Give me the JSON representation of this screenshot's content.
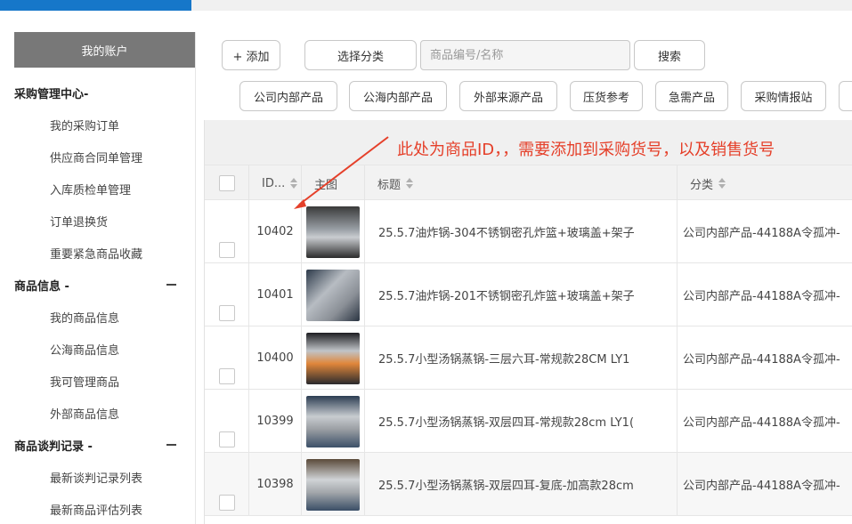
{
  "sidebar": {
    "account_label": "我的账户",
    "sections": [
      {
        "title": "采购管理中心-",
        "collapse": false,
        "items": [
          "我的采购订单",
          "供应商合同单管理",
          "入库质检单管理",
          "订单退换货",
          "重要紧急商品收藏"
        ]
      },
      {
        "title": "商品信息 -",
        "collapse": true,
        "items": [
          "我的商品信息",
          "公海商品信息",
          "我可管理商品",
          "外部商品信息"
        ]
      },
      {
        "title": "商品谈判记录 -",
        "collapse": true,
        "items": [
          "最新谈判记录列表",
          "最新商品评估列表"
        ]
      }
    ]
  },
  "toolbar": {
    "add_label": "+ 添加",
    "category_label": "选择分类",
    "search_placeholder": "商品编号/名称",
    "search_label": "搜索"
  },
  "filters": [
    "公司内部产品",
    "公海内部产品",
    "外部来源产品",
    "压货参考",
    "急需产品",
    "采购情报站"
  ],
  "table": {
    "columns": {
      "id": "ID...",
      "image": "主图",
      "title": "标题",
      "category": "分类"
    },
    "rows": [
      {
        "id": "10402",
        "title": "25.5.7油炸锅-304不锈钢密孔炸篮+玻璃盖+架子",
        "category": "公司内部产品-44188A令孤冲-"
      },
      {
        "id": "10401",
        "title": "25.5.7油炸锅-201不锈钢密孔炸篮+玻璃盖+架子",
        "category": "公司内部产品-44188A令孤冲-"
      },
      {
        "id": "10400",
        "title": "25.5.7小型汤锅蒸锅-三层六耳-常规款28CM LY1",
        "category": "公司内部产品-44188A令孤冲-"
      },
      {
        "id": "10399",
        "title": "25.5.7小型汤锅蒸锅-双层四耳-常规款28cm LY1(",
        "category": "公司内部产品-44188A令孤冲-"
      },
      {
        "id": "10398",
        "title": "25.5.7小型汤锅蒸锅-双层四耳-复底-加高款28cm",
        "category": "公司内部产品-44188A令孤冲-"
      }
    ]
  },
  "annotation": {
    "text": "此处为商品ID，，需要添加到采购货号，以及销售货号",
    "color": "#e5402a"
  },
  "colors": {
    "accent": "#1677c9",
    "account_bg": "#787878"
  }
}
